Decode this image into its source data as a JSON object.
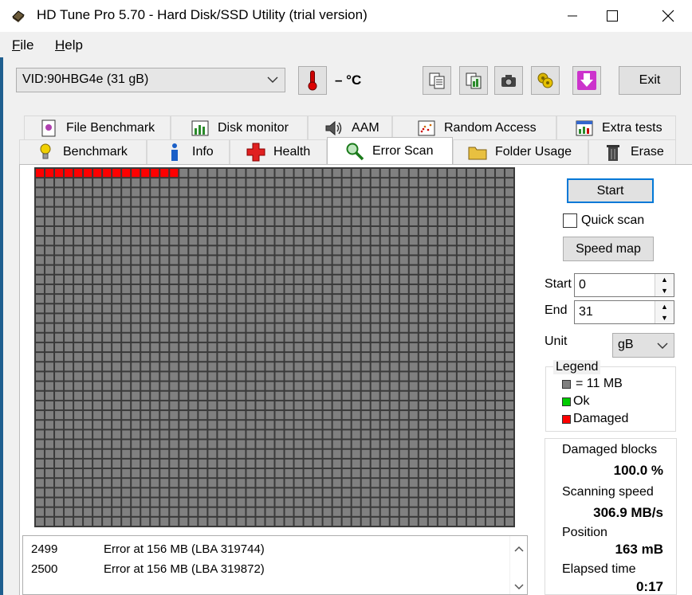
{
  "window": {
    "title": "HD Tune Pro 5.70 - Hard Disk/SSD Utility (trial version)"
  },
  "menu": {
    "file": "ile",
    "file_u": "F",
    "help": "elp",
    "help_u": "H"
  },
  "toolbar": {
    "drive": "VID:90HBG4e (31 gB)",
    "temperature": "– °C",
    "exit_label": "Exit"
  },
  "tabs": {
    "row1": [
      "File Benchmark",
      "Disk monitor",
      "AAM",
      "Random Access",
      "Extra tests"
    ],
    "row2": [
      "Benchmark",
      "Info",
      "Health",
      "Error Scan",
      "Folder Usage",
      "Erase"
    ],
    "active": "Error Scan"
  },
  "scan_grid": {
    "columns": 50,
    "rows": 37,
    "damaged_blocks": 15,
    "color_empty": "#808080",
    "color_ok": "#00cc00",
    "color_damaged": "#ff0000",
    "color_border": "#3a3a3a"
  },
  "controls": {
    "start_label": "Start",
    "quick_scan_label": "Quick scan",
    "quick_scan_checked": false,
    "speed_map_label": "Speed map",
    "start_field_label": "Start",
    "start_value": "0",
    "end_field_label": "End",
    "end_value": "31",
    "unit_label": "Unit",
    "unit_value": "gB"
  },
  "legend": {
    "title": "Legend",
    "block_size": "= 11 MB",
    "ok": "Ok",
    "damaged": "Damaged"
  },
  "stats": {
    "damaged_label": "Damaged blocks",
    "damaged_value": "100.0 %",
    "speed_label": "Scanning speed",
    "speed_value": "306.9 MB/s",
    "position_label": "Position",
    "position_value": "163 mB",
    "elapsed_label": "Elapsed time",
    "elapsed_value": "0:17"
  },
  "log": [
    {
      "num": "2499",
      "msg": "Error at 156 MB (LBA 319744)"
    },
    {
      "num": "2500",
      "msg": "Error at 156 MB (LBA 319872)"
    }
  ],
  "icons": {
    "app": "disk-app-icon",
    "thermometer": "thermometer-icon",
    "copy_text": "copy-text-icon",
    "copy_image": "copy-image-icon",
    "screenshot": "camera-icon",
    "options": "options-icon",
    "save": "save-arrow-icon"
  }
}
